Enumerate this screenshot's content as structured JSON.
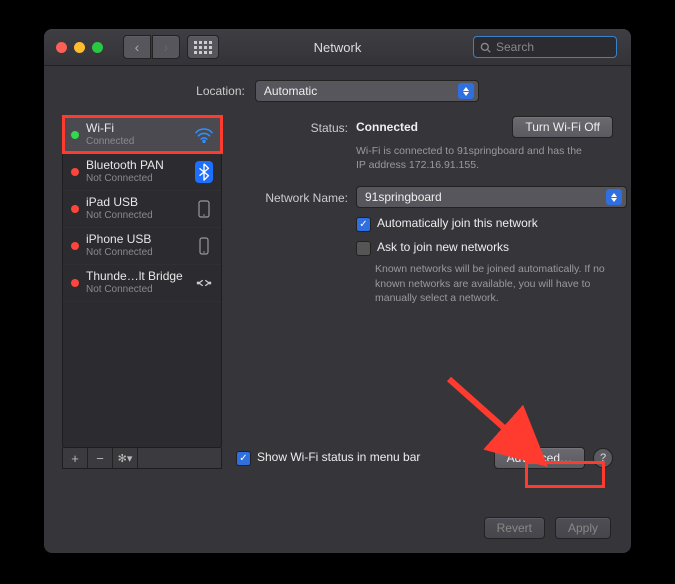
{
  "window": {
    "title": "Network",
    "search_placeholder": "Search"
  },
  "location": {
    "label": "Location:",
    "value": "Automatic"
  },
  "services": [
    {
      "name": "Wi-Fi",
      "sub": "Connected",
      "status": "green",
      "icon": "wifi",
      "selected": true
    },
    {
      "name": "Bluetooth PAN",
      "sub": "Not Connected",
      "status": "red",
      "icon": "bluetooth"
    },
    {
      "name": "iPad USB",
      "sub": "Not Connected",
      "status": "red",
      "icon": "device"
    },
    {
      "name": "iPhone USB",
      "sub": "Not Connected",
      "status": "red",
      "icon": "device"
    },
    {
      "name": "Thunde…lt Bridge",
      "sub": "Not Connected",
      "status": "red",
      "icon": "thunderbolt"
    }
  ],
  "status": {
    "label": "Status:",
    "value": "Connected",
    "turn_off_label": "Turn Wi-Fi Off",
    "detail": "Wi-Fi is connected to 91springboard and has the IP address 172.16.91.155."
  },
  "network_name": {
    "label": "Network Name:",
    "value": "91springboard"
  },
  "checks": {
    "auto_join": "Automatically join this network",
    "ask_join": "Ask to join new networks",
    "ask_join_note": "Known networks will be joined automatically. If no known networks are available, you will have to manually select a network."
  },
  "menu_bar": {
    "show_label": "Show Wi-Fi status in menu bar"
  },
  "buttons": {
    "advanced": "Advanced…",
    "revert": "Revert",
    "apply": "Apply"
  }
}
